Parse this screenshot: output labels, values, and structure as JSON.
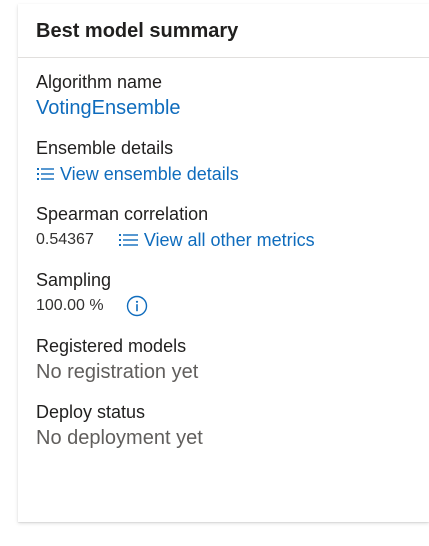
{
  "card": {
    "title": "Best model summary",
    "algorithm": {
      "label": "Algorithm name",
      "value": "VotingEnsemble"
    },
    "ensemble": {
      "label": "Ensemble details",
      "link_label": "View ensemble details",
      "icon": "list-icon"
    },
    "spearman": {
      "label": "Spearman correlation",
      "value": "0.54367",
      "link_label": "View all other metrics",
      "icon": "list-icon"
    },
    "sampling": {
      "label": "Sampling",
      "value": "100.00 %",
      "icon": "info-icon"
    },
    "registered": {
      "label": "Registered models",
      "value": "No registration yet"
    },
    "deploy": {
      "label": "Deploy status",
      "value": "No deployment yet"
    }
  },
  "colors": {
    "link": "#0f6cbd",
    "text": "#201f1e",
    "muted": "#605e5c",
    "divider": "#e1dfdd"
  }
}
